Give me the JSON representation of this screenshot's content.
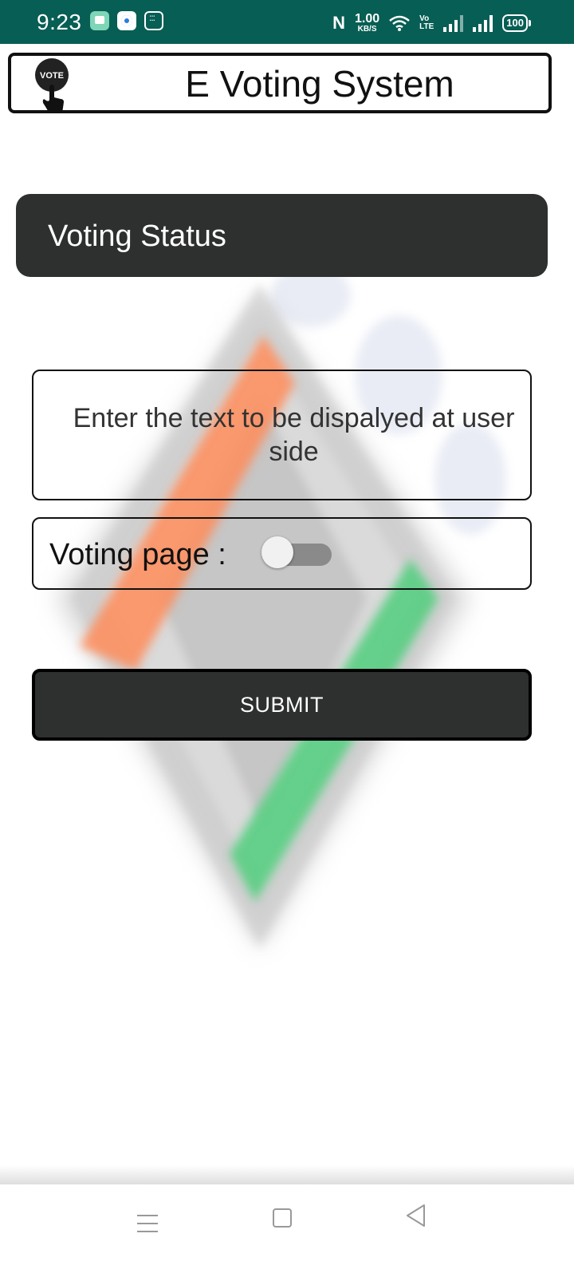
{
  "status_bar": {
    "time": "9:23",
    "nfc_symbol": "N",
    "data_speed_value": "1.00",
    "data_speed_unit": "KB/S",
    "volte_top": "Vo",
    "volte_bottom": "LTE",
    "battery": "100",
    "icons": [
      "message-icon",
      "browser-icon",
      "calculator-icon",
      "nfc-icon",
      "wifi-icon",
      "volte-icon",
      "signal-icon",
      "signal-icon",
      "battery-icon"
    ],
    "color": "#075e54"
  },
  "header": {
    "logo_text": "VOTE",
    "title": "E Voting System"
  },
  "status_card": {
    "title": "Voting Status",
    "color": "#2d302e"
  },
  "text_input": {
    "placeholder": "Enter the text to be dispalyed at user side"
  },
  "voting_page": {
    "label": "Voting page :",
    "toggle_on": false
  },
  "submit": {
    "label": "SUBMIT"
  },
  "nav_bar": {
    "icons": [
      "menu-icon",
      "home-icon",
      "back-icon"
    ]
  },
  "colors": {
    "saffron": "#ff8c5a",
    "green": "#4fce7c",
    "dark": "#2d302e"
  }
}
